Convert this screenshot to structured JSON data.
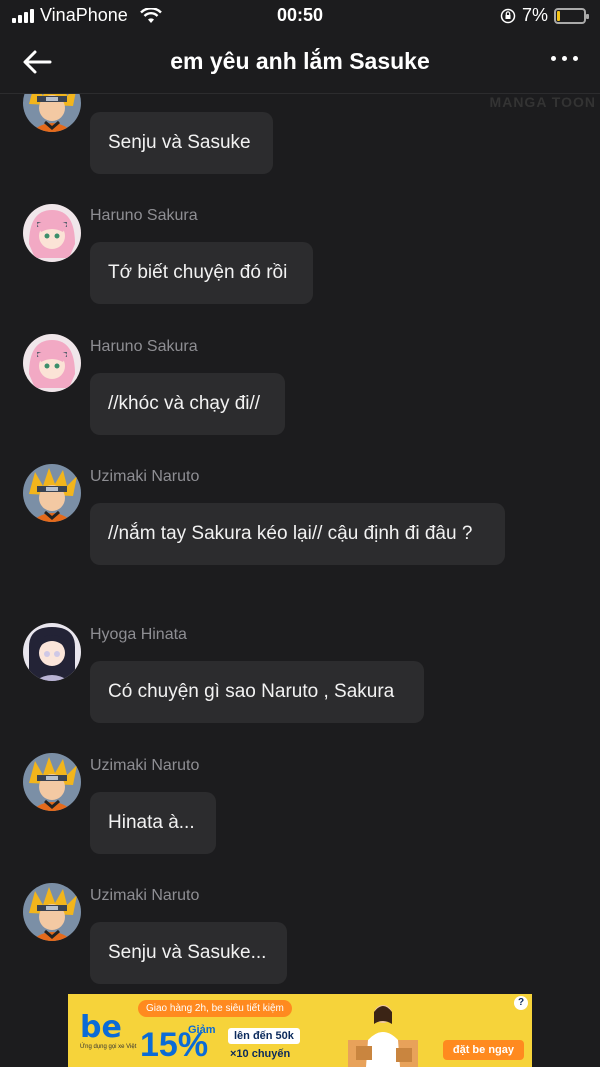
{
  "status_bar": {
    "carrier": "VinaPhone",
    "time": "00:50",
    "battery": "7%",
    "battery_level": 0.07
  },
  "header": {
    "title": "em yêu anh lắm Sasuke",
    "back_icon": "arrow-left-icon",
    "more_icon": "more-dots-icon"
  },
  "chat": {
    "watermark": "MANGA TOON",
    "messages": [
      {
        "sender": "",
        "avatar": "naruto",
        "text": "Senju và Sasuke"
      },
      {
        "sender": "Haruno Sakura",
        "avatar": "sakura",
        "text": "Tớ biết chuyện đó rồi"
      },
      {
        "sender": "Haruno Sakura",
        "avatar": "sakura",
        "text": "//khóc và chạy đi//"
      },
      {
        "sender": "Uzimaki Naruto",
        "avatar": "naruto",
        "text": "//nắm tay Sakura kéo lại// cậu định đi đâu ?"
      },
      {
        "sender": "Hyoga Hinata",
        "avatar": "hinata",
        "text": "Có chuyện gì sao Naruto , Sakura"
      },
      {
        "sender": "Uzimaki Naruto",
        "avatar": "naruto",
        "text": "Hinata à..."
      },
      {
        "sender": "Uzimaki Naruto",
        "avatar": "naruto",
        "text": "Senju và Sasuke..."
      }
    ]
  },
  "ad": {
    "logo": "be",
    "logo_sub": "Ứng dụng gọi xe Việt",
    "tag": "Giao hàng 2h, be siêu tiết kiệm",
    "giam": "Giảm",
    "percent": "15%",
    "up_to": "lên đến 50k",
    "times": "×10 chuyến",
    "cta": "đặt be ngay",
    "help": "?",
    "colors": {
      "background": "#f6d33a",
      "brand": "#0b6bd6",
      "accent": "#ff8a1f"
    }
  }
}
